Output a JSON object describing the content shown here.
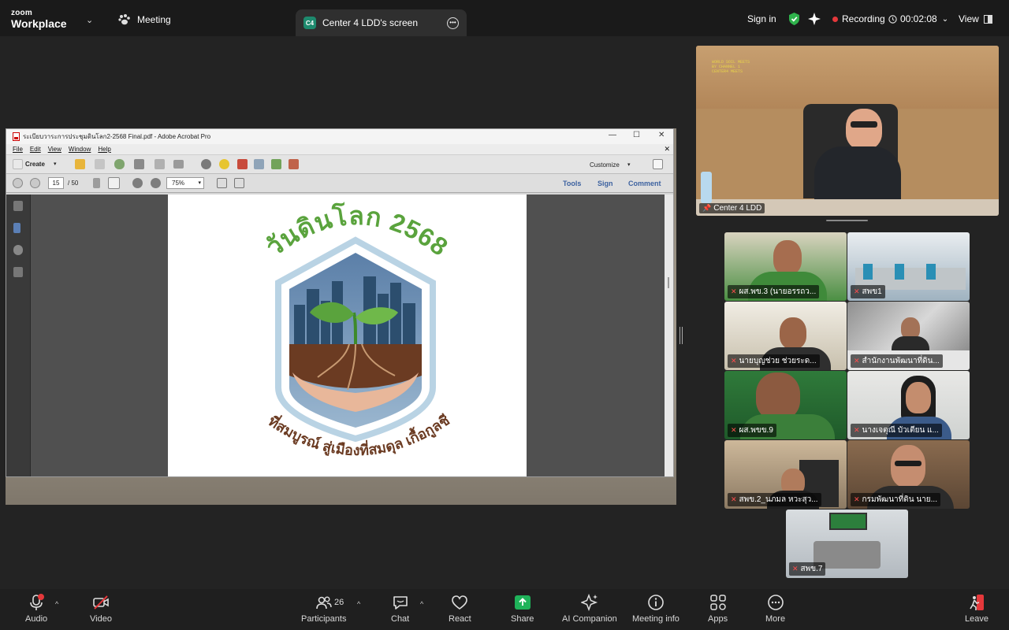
{
  "topbar": {
    "logo_line1": "zoom",
    "logo_line2": "Workplace",
    "meeting_label": "Meeting",
    "share_badge": "C4",
    "share_tab_label": "Center 4 LDD's screen",
    "sign_in": "Sign in",
    "recording": "Recording",
    "timer": "00:02:08",
    "view": "View"
  },
  "acrobat": {
    "title": "ระเบียบวาระการประชุมดินโลก2-2568 Final.pdf - Adobe Acrobat Pro",
    "menu": [
      "File",
      "Edit",
      "View",
      "Window",
      "Help"
    ],
    "create": "Create",
    "customize": "Customize",
    "page_current": "15",
    "page_total": "/ 50",
    "zoom": "75%",
    "tools": "Tools",
    "sign": "Sign",
    "comment": "Comment"
  },
  "poster": {
    "title": "วันดินโลก 2568",
    "slogan": "ดินที่สมบูรณ์ สู่เมืองที่สมดุล เกื้อกูลชีวิต"
  },
  "active_speaker": {
    "name": "Center 4 LDD",
    "screen_text": [
      "WORLD SOIL MEETS",
      "BY CHANNEL 1",
      "CENTER4 MEETS"
    ]
  },
  "participants": [
    "ผส.พข.3 (นายอรรถว...",
    "สพข1",
    "นายบุญช่วย ช่วยระด...",
    "สำนักงานพัฒนาที่ดิน...",
    "ผส.พขข.9",
    "นางเจตุณี บัวเตียน แ...",
    "สพข.2_นภมล หวะสุว...",
    "กรมพัฒนาที่ดิน นาย...",
    "สพข.7"
  ],
  "toolbar": {
    "audio": "Audio",
    "video": "Video",
    "participants": "Participants",
    "participants_count": "26",
    "chat": "Chat",
    "react": "React",
    "share": "Share",
    "ai_companion": "AI Companion",
    "meeting_info": "Meeting info",
    "apps": "Apps",
    "more": "More",
    "leave": "Leave"
  },
  "colors": {
    "recording_red": "#e5383b",
    "shield_green": "#2fb24c",
    "share_green": "#1fb35a",
    "poster_green": "#5aa33d",
    "poster_brown": "#6b3b22"
  }
}
